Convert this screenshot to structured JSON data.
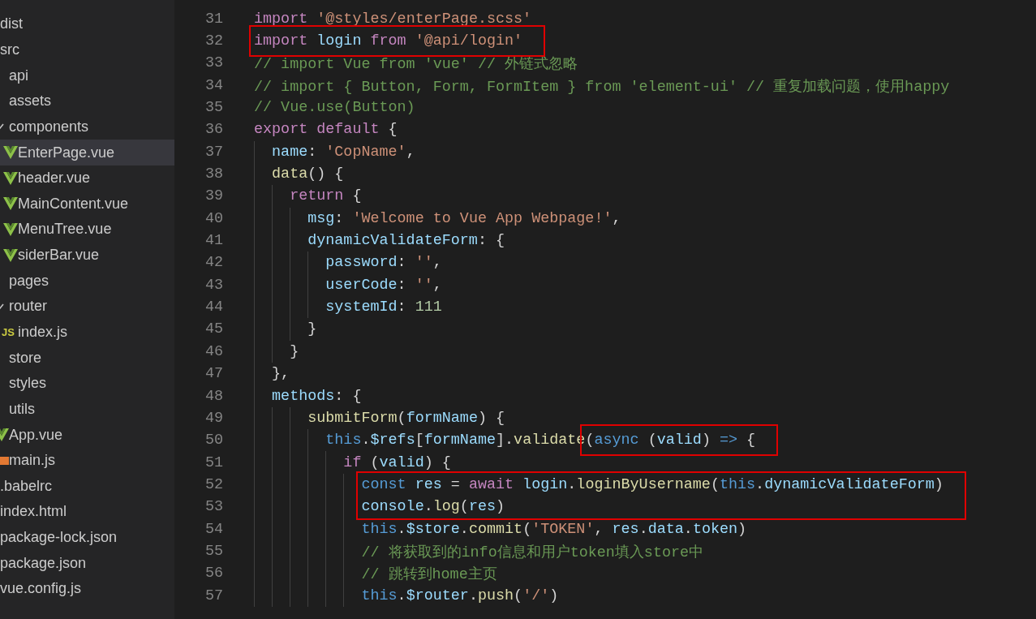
{
  "explorer": {
    "items": [
      {
        "name": "dist"
      },
      {
        "name": "src",
        "children": [
          {
            "name": "api"
          },
          {
            "name": "assets"
          },
          {
            "name": "components",
            "expanded": true,
            "children": [
              {
                "name": "EnterPage.vue",
                "kind": "vue",
                "selected": true
              },
              {
                "name": "header.vue",
                "kind": "vue",
                "selected": false
              },
              {
                "name": "MainContent.vue",
                "kind": "vue",
                "selected": false
              },
              {
                "name": "MenuTree.vue",
                "kind": "vue",
                "selected": false
              },
              {
                "name": "siderBar.vue",
                "kind": "vue",
                "selected": false
              }
            ]
          },
          {
            "name": "pages"
          },
          {
            "name": "router",
            "expanded": true,
            "children": [
              {
                "name": "index.js",
                "kind": "js",
                "badge": "JS"
              }
            ]
          },
          {
            "name": "store"
          },
          {
            "name": "styles"
          },
          {
            "name": "utils"
          },
          {
            "name": "App.vue",
            "kind": "vue"
          },
          {
            "name": "main.js",
            "kind": "script"
          }
        ]
      },
      {
        "name": ".babelrc"
      },
      {
        "name": "index.html"
      },
      {
        "name": "package-lock.json"
      },
      {
        "name": "package.json"
      },
      {
        "name": "vue.config.js"
      }
    ]
  },
  "editor": {
    "lines": [
      {
        "number": "31",
        "tokens": [
          {
            "kind": "keyword",
            "text": "import "
          },
          {
            "kind": "string",
            "text": "'@styles/enterPage.scss'"
          }
        ]
      },
      {
        "number": "32",
        "boxed_tokens": [
          {
            "kind": "keyword",
            "text": "import "
          },
          {
            "kind": "variable",
            "text": "login "
          },
          {
            "kind": "keyword",
            "text": "from "
          },
          {
            "kind": "string",
            "text": "'@api/login'"
          }
        ]
      },
      {
        "number": "33",
        "tokens": [
          {
            "kind": "comment",
            "text": "// import Vue from 'vue' // 外链式忽略"
          }
        ]
      },
      {
        "number": "34",
        "tokens": [
          {
            "kind": "comment",
            "text": "// import { Button, Form, FormItem } from 'element-ui' // 重复加载问题，使用happy"
          }
        ]
      },
      {
        "number": "35",
        "tokens": [
          {
            "kind": "comment",
            "text": "// Vue.use(Button)"
          }
        ]
      },
      {
        "number": "36",
        "tokens": [
          {
            "kind": "keyword",
            "text": "export default "
          },
          {
            "kind": "plain",
            "text": "{"
          }
        ]
      },
      {
        "number": "37",
        "tokens": [
          {
            "kind": "variable",
            "text": "  name"
          },
          {
            "kind": "plain",
            "text": ": "
          },
          {
            "kind": "string",
            "text": "'CopName'"
          },
          {
            "kind": "plain",
            "text": ","
          }
        ]
      },
      {
        "number": "38",
        "tokens": [
          {
            "kind": "function",
            "text": "  data"
          },
          {
            "kind": "plain",
            "text": "() {"
          }
        ]
      },
      {
        "number": "39",
        "tokens": [
          {
            "kind": "keyword",
            "text": "    return "
          },
          {
            "kind": "plain",
            "text": "{"
          }
        ]
      },
      {
        "number": "40",
        "tokens": [
          {
            "kind": "variable",
            "text": "      msg"
          },
          {
            "kind": "plain",
            "text": ": "
          },
          {
            "kind": "string",
            "text": "'Welcome to Vue App Webpage!'"
          },
          {
            "kind": "plain",
            "text": ","
          }
        ]
      },
      {
        "number": "41",
        "tokens": [
          {
            "kind": "variable",
            "text": "      dynamicValidateForm"
          },
          {
            "kind": "plain",
            "text": ": {"
          }
        ]
      },
      {
        "number": "42",
        "tokens": [
          {
            "kind": "variable",
            "text": "        password"
          },
          {
            "kind": "plain",
            "text": ": "
          },
          {
            "kind": "string",
            "text": "''"
          },
          {
            "kind": "plain",
            "text": ","
          }
        ]
      },
      {
        "number": "43",
        "tokens": [
          {
            "kind": "variable",
            "text": "        userCode"
          },
          {
            "kind": "plain",
            "text": ": "
          },
          {
            "kind": "string",
            "text": "''"
          },
          {
            "kind": "plain",
            "text": ","
          }
        ]
      },
      {
        "number": "44",
        "tokens": [
          {
            "kind": "variable",
            "text": "        systemId"
          },
          {
            "kind": "plain",
            "text": ": "
          },
          {
            "kind": "number",
            "text": "111"
          }
        ]
      },
      {
        "number": "45",
        "tokens": [
          {
            "kind": "plain",
            "text": "      }"
          }
        ]
      },
      {
        "number": "46",
        "tokens": [
          {
            "kind": "plain",
            "text": "    }"
          }
        ]
      },
      {
        "number": "47",
        "tokens": [
          {
            "kind": "plain",
            "text": "  },"
          }
        ]
      },
      {
        "number": "48",
        "tokens": [
          {
            "kind": "variable",
            "text": "  methods"
          },
          {
            "kind": "plain",
            "text": ": {"
          }
        ]
      },
      {
        "number": "49",
        "tokens": [
          {
            "kind": "function",
            "text": "      submitForm"
          },
          {
            "kind": "plain",
            "text": "("
          },
          {
            "kind": "variable",
            "text": "formName"
          },
          {
            "kind": "plain",
            "text": ") {"
          }
        ]
      },
      {
        "number": "50",
        "tokens": [
          {
            "kind": "storage",
            "text": "        this"
          },
          {
            "kind": "plain",
            "text": "."
          },
          {
            "kind": "variable",
            "text": "$refs"
          },
          {
            "kind": "plain",
            "text": "["
          },
          {
            "kind": "variable",
            "text": "formName"
          },
          {
            "kind": "plain",
            "text": "]."
          },
          {
            "kind": "function",
            "text": "validate"
          }
        ],
        "boxed_tokens": [
          {
            "kind": "plain",
            "text": "("
          },
          {
            "kind": "storage",
            "text": "async "
          },
          {
            "kind": "plain",
            "text": "("
          },
          {
            "kind": "variable",
            "text": "valid"
          },
          {
            "kind": "plain",
            "text": ") "
          },
          {
            "kind": "storage",
            "text": "=> "
          },
          {
            "kind": "plain",
            "text": "{"
          }
        ]
      },
      {
        "number": "51",
        "tokens": [
          {
            "kind": "keyword",
            "text": "          if "
          },
          {
            "kind": "plain",
            "text": "("
          },
          {
            "kind": "variable",
            "text": "valid"
          },
          {
            "kind": "plain",
            "text": ") {"
          }
        ]
      },
      {
        "number": "52",
        "boxed_tokens": [
          {
            "kind": "storage",
            "text": "            const "
          },
          {
            "kind": "variable",
            "text": "res "
          },
          {
            "kind": "plain",
            "text": "= "
          },
          {
            "kind": "keyword",
            "text": "await "
          },
          {
            "kind": "variable",
            "text": "login"
          },
          {
            "kind": "plain",
            "text": "."
          },
          {
            "kind": "function",
            "text": "loginByUsername"
          },
          {
            "kind": "plain",
            "text": "("
          },
          {
            "kind": "storage",
            "text": "this"
          },
          {
            "kind": "plain",
            "text": "."
          },
          {
            "kind": "variable",
            "text": "dynamicValidateForm"
          },
          {
            "kind": "plain",
            "text": ")"
          }
        ]
      },
      {
        "number": "53",
        "boxed_tokens": [
          {
            "kind": "variable",
            "text": "            console"
          },
          {
            "kind": "plain",
            "text": "."
          },
          {
            "kind": "function",
            "text": "log"
          },
          {
            "kind": "plain",
            "text": "("
          },
          {
            "kind": "variable",
            "text": "res"
          },
          {
            "kind": "plain",
            "text": ")"
          }
        ]
      },
      {
        "number": "54",
        "tokens": [
          {
            "kind": "storage",
            "text": "            this"
          },
          {
            "kind": "plain",
            "text": "."
          },
          {
            "kind": "variable",
            "text": "$store"
          },
          {
            "kind": "plain",
            "text": "."
          },
          {
            "kind": "function",
            "text": "commit"
          },
          {
            "kind": "plain",
            "text": "("
          },
          {
            "kind": "string",
            "text": "'TOKEN'"
          },
          {
            "kind": "plain",
            "text": ", "
          },
          {
            "kind": "variable",
            "text": "res"
          },
          {
            "kind": "plain",
            "text": "."
          },
          {
            "kind": "variable",
            "text": "data"
          },
          {
            "kind": "plain",
            "text": "."
          },
          {
            "kind": "variable",
            "text": "token"
          },
          {
            "kind": "plain",
            "text": ")"
          }
        ]
      },
      {
        "number": "55",
        "tokens": [
          {
            "kind": "comment",
            "text": "            // 将获取到的info信息和用户token填入store中"
          }
        ]
      },
      {
        "number": "56",
        "tokens": [
          {
            "kind": "comment",
            "text": "            // 跳转到home主页"
          }
        ]
      },
      {
        "number": "57",
        "tokens": [
          {
            "kind": "storage",
            "text": "            this"
          },
          {
            "kind": "plain",
            "text": "."
          },
          {
            "kind": "variable",
            "text": "$router"
          },
          {
            "kind": "plain",
            "text": "."
          },
          {
            "kind": "function",
            "text": "push"
          },
          {
            "kind": "plain",
            "text": "("
          },
          {
            "kind": "string",
            "text": "'/'"
          },
          {
            "kind": "plain",
            "text": ")"
          }
        ]
      }
    ]
  }
}
